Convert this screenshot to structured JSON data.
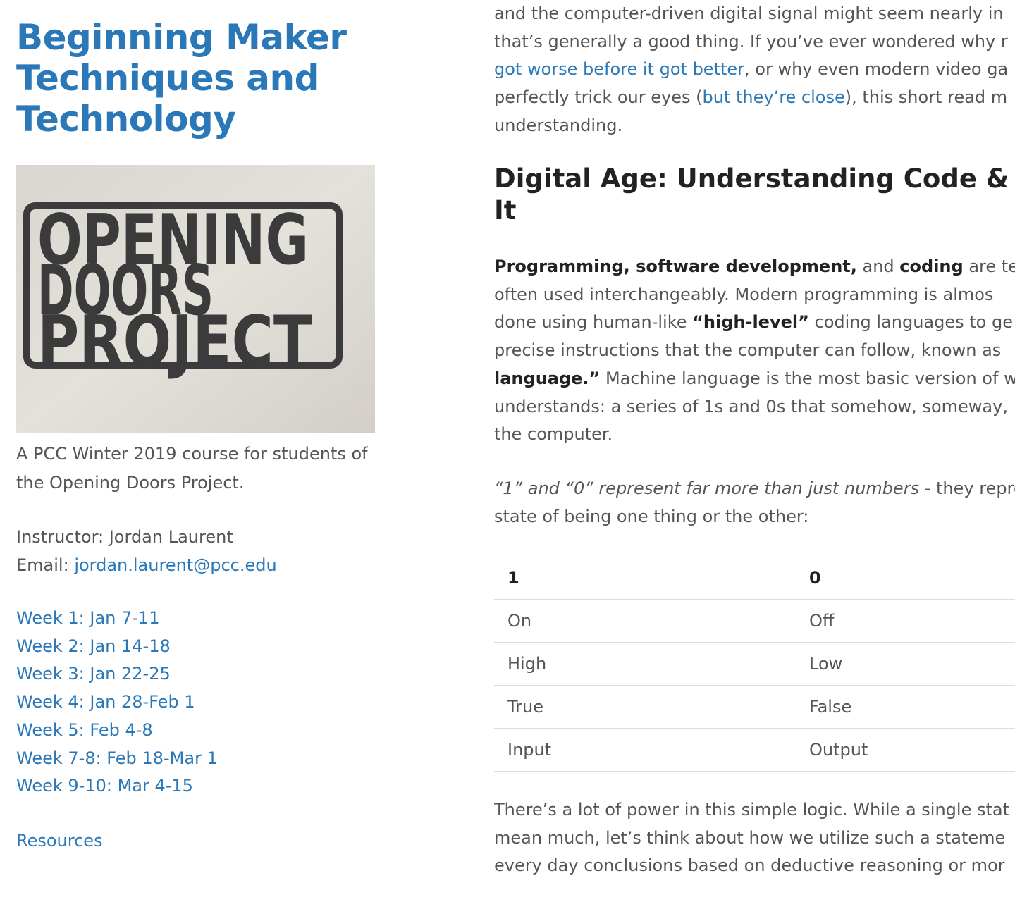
{
  "sidebar": {
    "title_lines": [
      "Beginning Maker",
      "Techniques and",
      "Technology"
    ],
    "logo": {
      "alt": "Opening Doors Project sign",
      "lines": [
        "OPENING",
        "DOORS",
        "PROJECT"
      ]
    },
    "caption": "A PCC Winter 2019 course for students of the Opening Doors Project.",
    "instructor_label": "Instructor: Jordan Laurent",
    "email_label": "Email: ",
    "email": "jordan.laurent@pcc.edu",
    "weeks": [
      "Week 1: Jan 7-11",
      "Week 2: Jan 14-18",
      "Week 3: Jan 22-25",
      "Week 4: Jan 28-Feb 1",
      "Week 5: Feb 4-8",
      "Week 7-8: Feb 18-Mar 1",
      "Week 9-10: Mar 4-15"
    ],
    "resources": "Resources"
  },
  "main": {
    "intro": {
      "line1": "and the computer-driven digital signal might seem nearly in",
      "line2": "that’s generally a good thing. If you’ve ever wondered why r",
      "line3_link": "got worse before it got better",
      "line3_text": ", or why even modern video ga",
      "line4_a": "perfectly trick our eyes (",
      "line4_link": "but they’re close",
      "line4_b": "), this short read m",
      "line5": "understanding."
    },
    "heading_lines": [
      "Digital Age: Understanding Code & Wh",
      "It"
    ],
    "programming": {
      "b1": "Programming, software development,",
      "t1": " and ",
      "b2": "coding",
      "t2": " are ter",
      "line2": "often used interchangeably. Modern programming is almos",
      "l3a": "done using human-like ",
      "l3b": "“high-level”",
      "l3c": " coding languages to ge",
      "line4": "precise instructions that the computer can follow, known as",
      "l5a": "language.”",
      "l5b": " Machine language is the most basic version of w",
      "line6": "understands: a series of 1s and 0s that somehow, someway,",
      "line7": "the computer."
    },
    "represent": {
      "em": "“1” and “0” represent far more than just numbers",
      "rest": " - they represe",
      "line2": "state of being one thing or the other:"
    },
    "table": {
      "headers": [
        "1",
        "0"
      ],
      "rows": [
        [
          "On",
          "Off"
        ],
        [
          "High",
          "Low"
        ],
        [
          "True",
          "False"
        ],
        [
          "Input",
          "Output"
        ]
      ]
    },
    "power": {
      "line1": "There’s a lot of power in this simple logic. While a single stat",
      "line2": "mean much, let’s think about how we utilize such a stateme",
      "line3": "every day conclusions based on deductive reasoning or mor"
    }
  },
  "colors": {
    "link": "#2a78b8",
    "body_text": "#555555",
    "heading_text": "#222222",
    "table_rule": "#dddddd"
  }
}
